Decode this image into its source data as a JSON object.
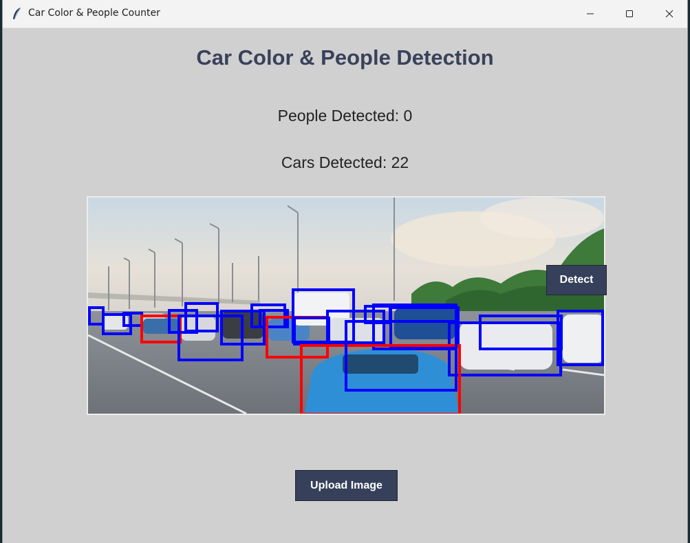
{
  "window": {
    "title": "Car Color & People Counter",
    "app_icon": "feather-icon",
    "controls": [
      "minimize-icon",
      "maximize-icon",
      "close-icon"
    ]
  },
  "main": {
    "heading": "Car Color & People Detection",
    "people_detected": "People Detected: 0",
    "cars_detected": "Cars Detected: 22"
  },
  "buttons": {
    "detect": "Detect",
    "upload": "Upload Image"
  },
  "colors": {
    "background": "#d0d0d0",
    "button": "#36405a",
    "heading": "#39415a",
    "box_blue": "#0000ff",
    "box_red": "#ff0000"
  },
  "image": {
    "description_icon": "highway-traffic-photo",
    "box_colors": [
      "blue",
      "red"
    ]
  }
}
